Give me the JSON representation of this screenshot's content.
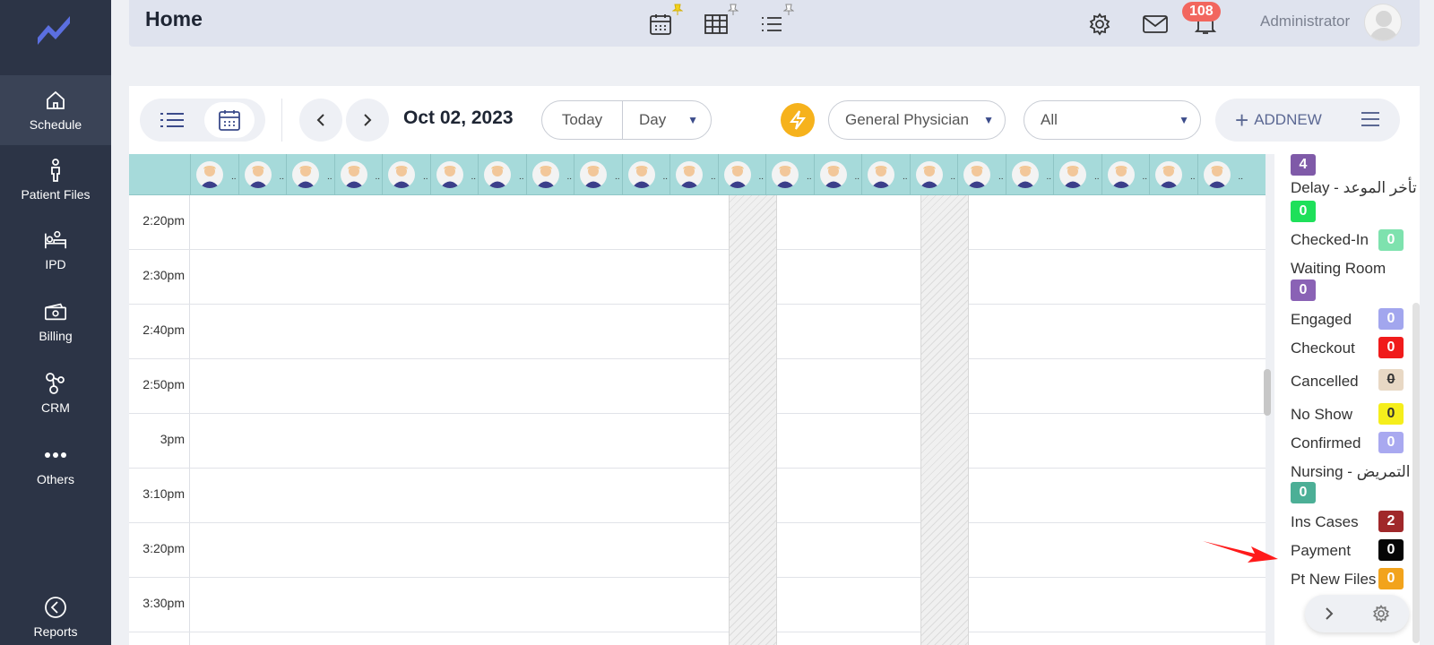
{
  "sidebar": {
    "items": [
      {
        "label": "Schedule",
        "icon": "home-icon"
      },
      {
        "label": "Patient Files",
        "icon": "person-icon"
      },
      {
        "label": "IPD",
        "icon": "bed-icon"
      },
      {
        "label": "Billing",
        "icon": "money-icon"
      },
      {
        "label": "CRM",
        "icon": "crm-icon"
      },
      {
        "label": "Others",
        "icon": "dots-icon"
      },
      {
        "label": "Reports",
        "icon": "reports-icon"
      }
    ]
  },
  "header": {
    "title": "Home",
    "notification_count": "108",
    "user_name": "Administrator"
  },
  "toolbar": {
    "date": "Oct 02, 2023",
    "today_label": "Today",
    "view_value": "Day",
    "physician_value": "General Physician",
    "filter_value": "All",
    "addnew_label": "ADDNEW"
  },
  "calendar": {
    "times": [
      "2:20pm",
      "2:30pm",
      "2:40pm",
      "2:50pm",
      "3pm",
      "3:10pm",
      "3:20pm",
      "3:30pm"
    ],
    "header_color": "#a6dada"
  },
  "legend": {
    "items": [
      {
        "label": "",
        "count": "4",
        "color": "#7f5aa8"
      },
      {
        "label": "Delay - تأخر الموعد",
        "count": "0",
        "color": "#1ee05a"
      },
      {
        "label": "Checked-In",
        "count": "0",
        "color": "#7ee2ae"
      },
      {
        "label": "Waiting Room",
        "count": "0",
        "color": "#8a62b5"
      },
      {
        "label": "Engaged",
        "count": "0",
        "color": "#a2a6ee"
      },
      {
        "label": "Checkout",
        "count": "0",
        "color": "#f01b1b"
      },
      {
        "label": "Cancelled",
        "count": "0",
        "color": "#e8d8c4"
      },
      {
        "label": "No Show",
        "count": "0",
        "color": "#f5ee1c"
      },
      {
        "label": "Confirmed",
        "count": "0",
        "color": "#a9a9f0"
      },
      {
        "label": "Nursing - التمريض",
        "count": "0",
        "color": "#4caf96"
      },
      {
        "label": "Ins Cases",
        "count": "2",
        "color": "#a0282a"
      },
      {
        "label": "Payment",
        "count": "0",
        "color": "#050505"
      },
      {
        "label": "Pt New Files",
        "count": "0",
        "color": "#f2a31c"
      }
    ]
  }
}
